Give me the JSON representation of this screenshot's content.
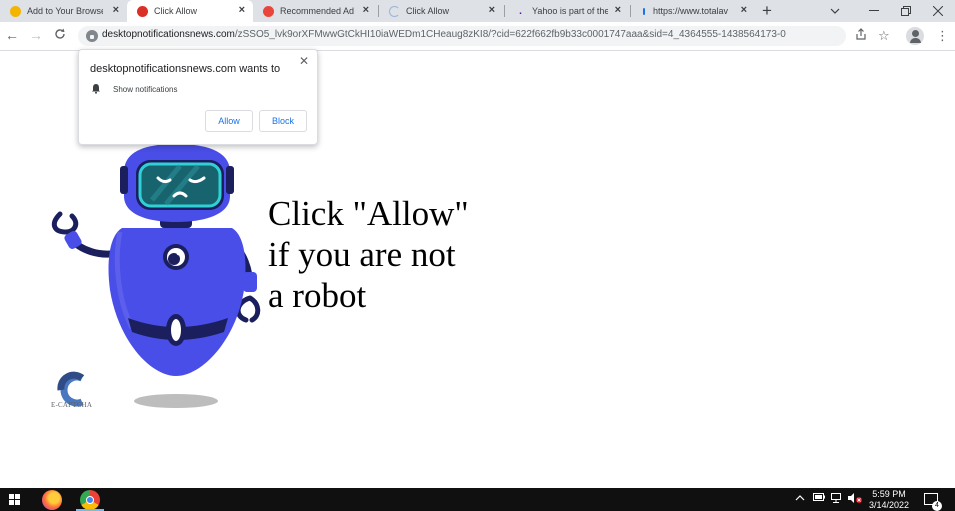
{
  "browser": {
    "tabs": [
      {
        "label": "Add to Your Browse",
        "favicon_color": "#f4b400",
        "active": false
      },
      {
        "label": "Click Allow",
        "favicon_color": "#d93025",
        "active": true
      },
      {
        "label": "Recommended Ad",
        "favicon_color": "#e8453c",
        "active": false
      },
      {
        "label": "Click Allow",
        "favicon_color": "#9ab5d8",
        "active": false
      },
      {
        "label": "Yahoo is part of the",
        "favicon_color": "#6001d2",
        "active": false
      },
      {
        "label": "https://www.totalav",
        "favicon_color": "#1a73e8",
        "active": false
      }
    ],
    "close_glyph": "×",
    "new_tab_glyph": "+",
    "url_host": "desktopnotificationsnews.com",
    "url_path": "/zSSO5_lvk9orXFMwwGtCkHI10iaWEDm1CHeaug8zKI8/?cid=622f662fb9b33c0001747aaa&sid=4_4364555-1438564173-0"
  },
  "permission_prompt": {
    "title": "desktopnotificationsnews.com wants to",
    "permission": "Show notifications",
    "allow_label": "Allow",
    "block_label": "Block"
  },
  "page": {
    "headline_lines": [
      "Click \"Allow\"",
      "if you are not",
      "a robot"
    ],
    "captcha_label": "E-CAPTCHA"
  },
  "taskbar": {
    "time": "5:59 PM",
    "date": "3/14/2022",
    "notification_count": "4"
  },
  "colors": {
    "robot_body": "#4a4ee8",
    "robot_dark": "#1b1f5e",
    "visor": "#2fd1d6",
    "link_blue": "#1a73e8"
  }
}
